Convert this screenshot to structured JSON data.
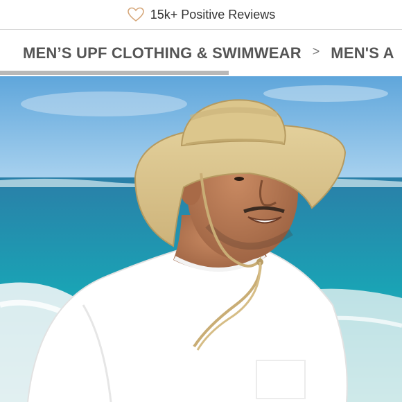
{
  "top_bar": {
    "icon": "heart-outline-icon",
    "icon_color": "#d6a77a",
    "reviews_text": "15k+ Positive Reviews"
  },
  "breadcrumb": {
    "items": [
      {
        "label": "MEN’S UPF CLOTHING & SWIMWEAR"
      },
      {
        "label": "MEN'S A"
      }
    ],
    "separator": ">",
    "text_color": "#555555"
  },
  "hero": {
    "image": "man-in-wide-brim-sun-hat-on-beach",
    "colors": {
      "sky": "#7fb8e0",
      "ocean": "#1f8fa8",
      "hat": "#d9c48f",
      "shirt": "#ffffff"
    }
  }
}
